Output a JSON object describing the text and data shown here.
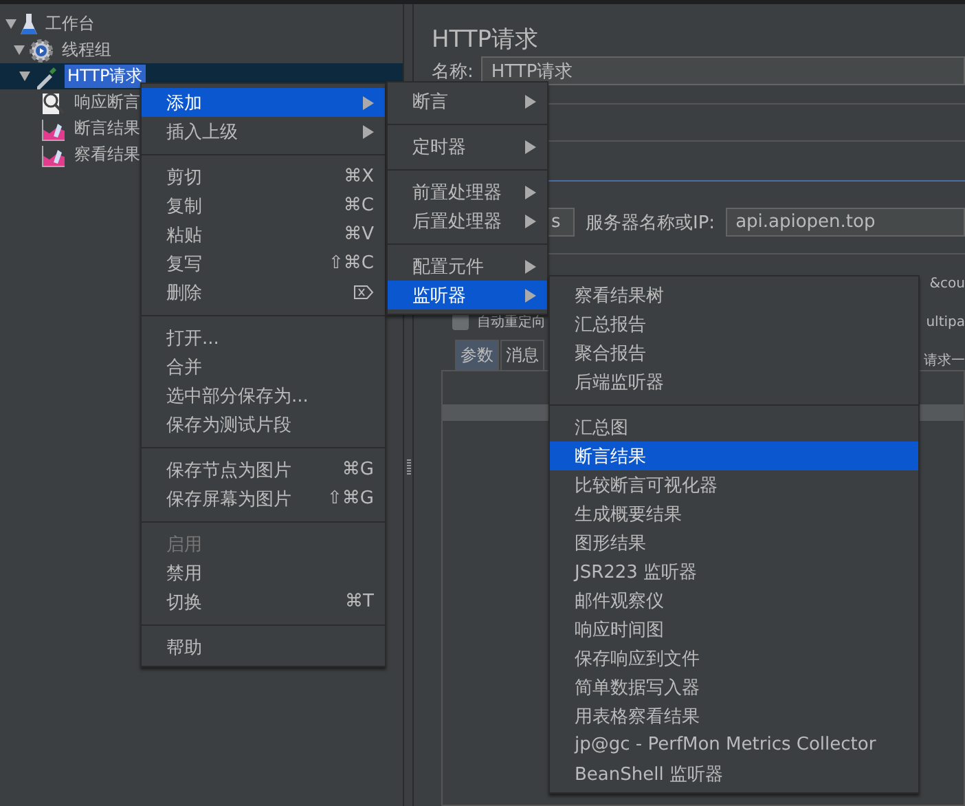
{
  "tree": [
    {
      "label": "工作台",
      "kind": "workbench",
      "expanded": true,
      "selected": false,
      "children": [
        {
          "label": "线程组",
          "kind": "thread-group",
          "expanded": true,
          "selected": false,
          "children": [
            {
              "label": "HTTP请求",
              "kind": "sampler",
              "expanded": true,
              "selected": true,
              "children": [
                {
                  "label": "响应断言",
                  "kind": "assertion",
                  "selected": false
                },
                {
                  "label": "断言结果",
                  "kind": "listener",
                  "selected": false
                },
                {
                  "label": "察看结果",
                  "kind": "listener",
                  "selected": false
                }
              ]
            }
          ]
        }
      ]
    }
  ],
  "editor": {
    "title": "HTTP请求",
    "name_label": "名称:",
    "name_value": "HTTP请求",
    "port_value": "s",
    "server_label": "服务器名称或IP:",
    "server_value": "api.apiopen.top",
    "cut_text_1": "&cou",
    "redirect_label": "自动重定向",
    "redirect_checked": false,
    "cut_text_2": "ultipa",
    "tabs": [
      {
        "label": "参数",
        "selected": true
      },
      {
        "label": "消息",
        "selected": false
      }
    ],
    "cut_text_3": "请求一"
  },
  "menus": [
    {
      "items": [
        {
          "kind": "item",
          "label": "添加",
          "submenu": true,
          "selected": true,
          "disabled": false
        },
        {
          "kind": "item",
          "label": "插入上级",
          "submenu": true,
          "selected": false,
          "disabled": false
        },
        {
          "kind": "separator"
        },
        {
          "kind": "item",
          "label": "剪切",
          "shortcut": "⌘X",
          "selected": false,
          "disabled": false
        },
        {
          "kind": "item",
          "label": "复制",
          "shortcut": "⌘C",
          "selected": false,
          "disabled": false
        },
        {
          "kind": "item",
          "label": "粘贴",
          "shortcut": "⌘V",
          "selected": false,
          "disabled": false
        },
        {
          "kind": "item",
          "label": "复写",
          "shortcut": "⇧⌘C",
          "selected": false,
          "disabled": false
        },
        {
          "kind": "item",
          "label": "删除",
          "delete_key": true,
          "selected": false,
          "disabled": false
        },
        {
          "kind": "separator"
        },
        {
          "kind": "item",
          "label": "打开...",
          "selected": false,
          "disabled": false
        },
        {
          "kind": "item",
          "label": "合并",
          "selected": false,
          "disabled": false
        },
        {
          "kind": "item",
          "label": "选中部分保存为...",
          "selected": false,
          "disabled": false
        },
        {
          "kind": "item",
          "label": "保存为测试片段",
          "selected": false,
          "disabled": false
        },
        {
          "kind": "separator"
        },
        {
          "kind": "item",
          "label": "保存节点为图片",
          "shortcut": "⌘G",
          "selected": false,
          "disabled": false
        },
        {
          "kind": "item",
          "label": "保存屏幕为图片",
          "shortcut": "⇧⌘G",
          "selected": false,
          "disabled": false
        },
        {
          "kind": "separator"
        },
        {
          "kind": "item",
          "label": "启用",
          "selected": false,
          "disabled": true
        },
        {
          "kind": "item",
          "label": "禁用",
          "selected": false,
          "disabled": false
        },
        {
          "kind": "item",
          "label": "切换",
          "shortcut": "⌘T",
          "selected": false,
          "disabled": false
        },
        {
          "kind": "separator"
        },
        {
          "kind": "item",
          "label": "帮助",
          "selected": false,
          "disabled": false
        }
      ]
    },
    {
      "items": [
        {
          "kind": "item",
          "label": "断言",
          "submenu": true,
          "selected": false,
          "disabled": false
        },
        {
          "kind": "separator"
        },
        {
          "kind": "item",
          "label": "定时器",
          "submenu": true,
          "selected": false,
          "disabled": false
        },
        {
          "kind": "separator"
        },
        {
          "kind": "item",
          "label": "前置处理器",
          "submenu": true,
          "selected": false,
          "disabled": false
        },
        {
          "kind": "item",
          "label": "后置处理器",
          "submenu": true,
          "selected": false,
          "disabled": false
        },
        {
          "kind": "separator"
        },
        {
          "kind": "item",
          "label": "配置元件",
          "submenu": true,
          "selected": false,
          "disabled": false
        },
        {
          "kind": "item",
          "label": "监听器",
          "submenu": true,
          "selected": true,
          "disabled": false
        }
      ]
    },
    {
      "items": [
        {
          "kind": "item",
          "label": "察看结果树",
          "selected": false,
          "disabled": false
        },
        {
          "kind": "item",
          "label": "汇总报告",
          "selected": false,
          "disabled": false
        },
        {
          "kind": "item",
          "label": "聚合报告",
          "selected": false,
          "disabled": false
        },
        {
          "kind": "item",
          "label": "后端监听器",
          "selected": false,
          "disabled": false
        },
        {
          "kind": "separator"
        },
        {
          "kind": "item",
          "label": "汇总图",
          "selected": false,
          "disabled": false
        },
        {
          "kind": "item",
          "label": "断言结果",
          "selected": true,
          "disabled": false
        },
        {
          "kind": "item",
          "label": "比较断言可视化器",
          "selected": false,
          "disabled": false
        },
        {
          "kind": "item",
          "label": "生成概要结果",
          "selected": false,
          "disabled": false
        },
        {
          "kind": "item",
          "label": "图形结果",
          "selected": false,
          "disabled": false
        },
        {
          "kind": "item",
          "label": "JSR223 监听器",
          "selected": false,
          "disabled": false
        },
        {
          "kind": "item",
          "label": "邮件观察仪",
          "selected": false,
          "disabled": false
        },
        {
          "kind": "item",
          "label": "响应时间图",
          "selected": false,
          "disabled": false
        },
        {
          "kind": "item",
          "label": "保存响应到文件",
          "selected": false,
          "disabled": false
        },
        {
          "kind": "item",
          "label": "简单数据写入器",
          "selected": false,
          "disabled": false
        },
        {
          "kind": "item",
          "label": "用表格察看结果",
          "selected": false,
          "disabled": false
        },
        {
          "kind": "item",
          "label": "jp@gc - PerfMon Metrics Collector",
          "selected": false,
          "disabled": false
        },
        {
          "kind": "item",
          "label": "BeanShell 监听器",
          "selected": false,
          "disabled": false
        }
      ]
    }
  ]
}
